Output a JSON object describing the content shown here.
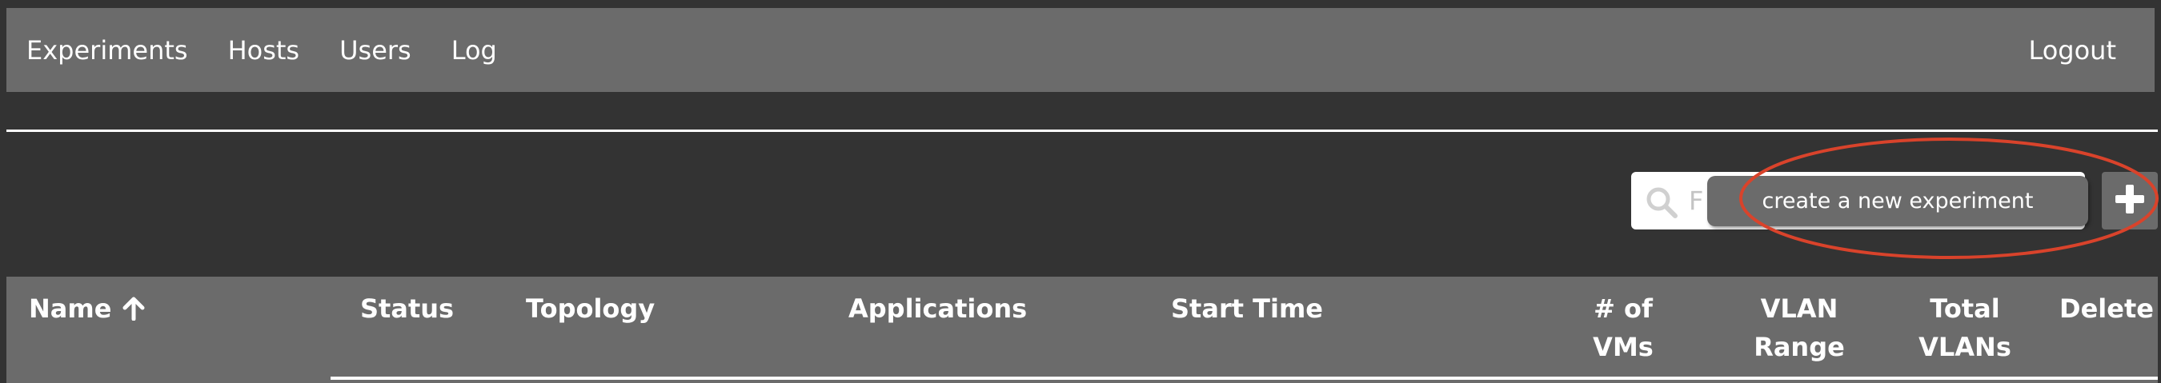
{
  "nav": {
    "items": [
      {
        "label": "Experiments"
      },
      {
        "label": "Hosts"
      },
      {
        "label": "Users"
      },
      {
        "label": "Log"
      }
    ],
    "logout_label": "Logout"
  },
  "search": {
    "placeholder": "F"
  },
  "tooltip": {
    "text": "create a new experiment"
  },
  "add_button": {
    "icon": "plus-icon"
  },
  "highlight": {
    "color": "#d9432b"
  },
  "table": {
    "columns": {
      "name": "Name",
      "status": "Status",
      "topology": "Topology",
      "applications": "Applications",
      "start_time": "Start Time",
      "num_vms_line1": "# of",
      "num_vms_line2": "VMs",
      "vlan_range_line1": "VLAN",
      "vlan_range_line2": "Range",
      "total_vlans_line1": "Total",
      "total_vlans_line2": "VLANs",
      "delete": "Delete"
    },
    "sort_icon": "arrow-up-icon"
  },
  "colors": {
    "background": "#333333",
    "bar": "#6b6b6b",
    "text": "#ffffff",
    "annotation": "#d9432b"
  }
}
